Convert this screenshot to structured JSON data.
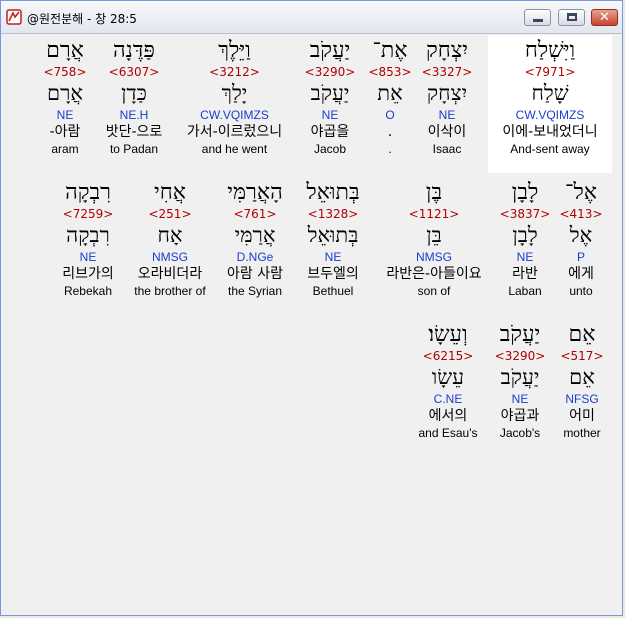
{
  "window": {
    "title": "@원전분해 - 창 28:5",
    "close_glyph": "✕"
  },
  "rows": [
    [
      {
        "heb": "וַיִּשְׁלַח",
        "strong": "<7971>",
        "lemma": "שָׁלַח",
        "morph": "CW.VQIMZS",
        "kor": "이에-보내었더니",
        "eng": "And-sent away",
        "selected": true
      },
      {
        "heb": "יִצְחָק",
        "strong": "<3327>",
        "lemma": "יִצְחָק",
        "morph": "NE",
        "kor": "이삭이",
        "eng": "Isaac"
      },
      {
        "heb": "אֶת־",
        "strong": "<853>",
        "lemma": "אֵת",
        "morph": "O",
        "kor": ".",
        "eng": "."
      },
      {
        "heb": "יַעֲקֹב",
        "strong": "<3290>",
        "lemma": "יַעֲקֹב",
        "morph": "NE",
        "kor": "야곱을",
        "eng": "Jacob"
      },
      {
        "heb": "וַיֵּלֶךְ",
        "strong": "<3212>",
        "lemma": "יָלַךְ",
        "morph": "CW.VQIMZS",
        "kor": "가서-이르렀으니",
        "eng": "and he went"
      },
      {
        "heb": "פַּדֶּנָה",
        "strong": "<6307>",
        "lemma": "כַּדָן",
        "morph": "NE.H",
        "kor": "밧단-으로",
        "eng": "to Padan"
      },
      {
        "heb": "אֲרָם",
        "strong": "<758>",
        "lemma": "אֲרָם",
        "morph": "NE",
        "kor": "-아람",
        "eng": "aram"
      }
    ],
    [
      {
        "heb": "אֶל־",
        "strong": "<413>",
        "lemma": "אֶל",
        "morph": "P",
        "kor": "에게",
        "eng": "unto"
      },
      {
        "heb": "לָבָן",
        "strong": "<3837>",
        "lemma": "לָבָן",
        "morph": "NE",
        "kor": "라반",
        "eng": "Laban"
      },
      {
        "heb": "בֶּן",
        "strong": "<1121>",
        "lemma": "בֵּן",
        "morph": "NMSG",
        "kor": "라반은-아들이요",
        "eng": "son of"
      },
      {
        "heb": "בְּתוּאֵל",
        "strong": "<1328>",
        "lemma": "בְּתוּאֵל",
        "morph": "NE",
        "kor": "브두엘의",
        "eng": "Bethuel"
      },
      {
        "heb": "הָאֲרַמִּי",
        "strong": "<761>",
        "lemma": "אֲרַמִּי",
        "morph": "D.NGe",
        "kor": "아람 사람",
        "eng": "the Syrian"
      },
      {
        "heb": "אֲחִי",
        "strong": "<251>",
        "lemma": "אָח",
        "morph": "NMSG",
        "kor": "오라비더라",
        "eng": "the brother of"
      },
      {
        "heb": "רִבְקָה",
        "strong": "<7259>",
        "lemma": "רִבְקָה",
        "morph": "NE",
        "kor": "리브가의",
        "eng": "Rebekah"
      }
    ],
    [
      {
        "heb": "אֵם",
        "strong": "<517>",
        "lemma": "אֵם",
        "morph": "NFSG",
        "kor": "어미",
        "eng": "mother"
      },
      {
        "heb": "יַעֲקֹב",
        "strong": "<3290>",
        "lemma": "יַעֲקֹב",
        "morph": "NE",
        "kor": "야곱과",
        "eng": "Jacob's"
      },
      {
        "heb": "וְעֵשָׂו׃",
        "strong": "<6215>",
        "lemma": "עֵשָׂו",
        "morph": "C.NE",
        "kor": "에서의",
        "eng": "and Esau's"
      }
    ]
  ]
}
